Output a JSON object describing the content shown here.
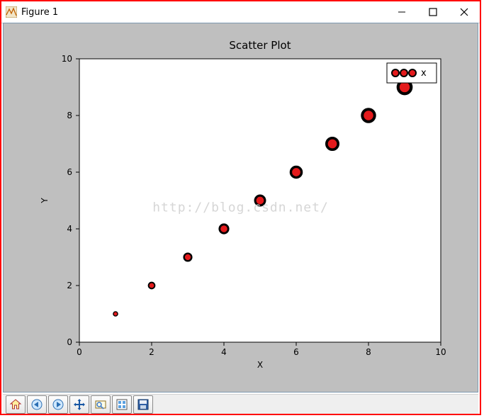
{
  "window": {
    "title": "Figure 1"
  },
  "watermark": "http://blog.csdn.net/",
  "chart_data": {
    "type": "scatter",
    "title": "Scatter Plot",
    "xlabel": "X",
    "ylabel": "Y",
    "xlim": [
      0,
      10
    ],
    "ylim": [
      0,
      10
    ],
    "xticks": [
      0,
      2,
      4,
      6,
      8,
      10
    ],
    "yticks": [
      0,
      2,
      4,
      6,
      8,
      10
    ],
    "series": [
      {
        "name": "x",
        "x": [
          1,
          2,
          3,
          4,
          5,
          6,
          7,
          8,
          9
        ],
        "y": [
          1,
          2,
          3,
          4,
          5,
          6,
          7,
          8,
          9
        ],
        "sizes": [
          30,
          60,
          90,
          120,
          150,
          180,
          210,
          240,
          270
        ],
        "face": "#e41a1c",
        "edge": "#000000"
      }
    ],
    "legend": {
      "position": "upper right",
      "entries": [
        "x"
      ]
    }
  }
}
